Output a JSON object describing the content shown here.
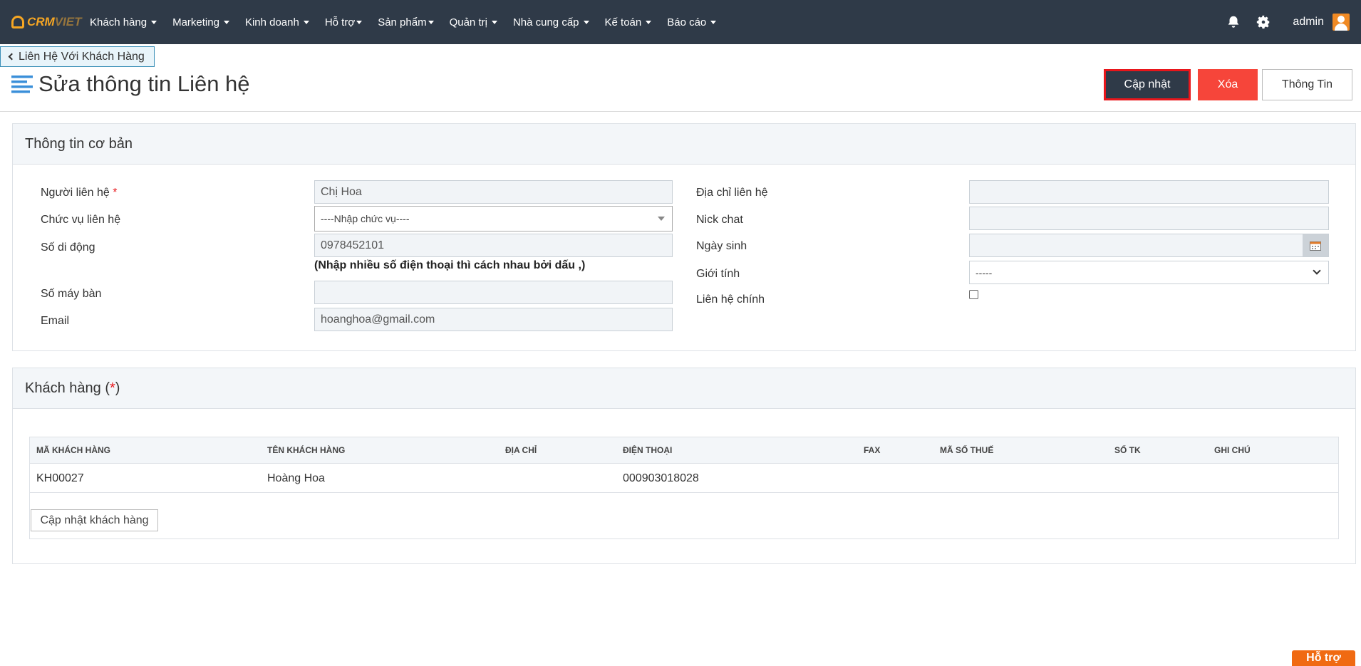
{
  "nav": {
    "logo_crm": "CRM",
    "logo_viet": "VIET",
    "menu": [
      {
        "label": "Khách hàng"
      },
      {
        "label": "Marketing"
      },
      {
        "label": "Kinh doanh"
      },
      {
        "label": "Hỗ trợ"
      },
      {
        "label": "Sản phẩm"
      },
      {
        "label": "Quản trị"
      },
      {
        "label": "Nhà cung cấp"
      },
      {
        "label": "Kế toán"
      },
      {
        "label": "Báo cáo"
      }
    ],
    "user": "admin"
  },
  "breadcrumb": {
    "back_label": "Liên Hệ Với Khách Hàng"
  },
  "page": {
    "title": "Sửa thông tin Liên hệ"
  },
  "actions": {
    "update": "Cập nhật",
    "delete": "Xóa",
    "info": "Thông Tin"
  },
  "basic_info": {
    "heading": "Thông tin cơ bản",
    "contact_person": {
      "label": "Người liên hệ",
      "required": "*",
      "value": "Chị Hoa"
    },
    "position": {
      "label": "Chức vụ liên hệ",
      "value": "----Nhập chức vụ----"
    },
    "mobile": {
      "label": "Số di động",
      "value": "0978452101",
      "hint": "(Nhập nhiều số điện thoại thì cách nhau bởi dấu ,)"
    },
    "landline": {
      "label": "Số máy bàn",
      "value": ""
    },
    "email": {
      "label": "Email",
      "value": "hoanghoa@gmail.com"
    },
    "address": {
      "label": "Địa chỉ liên hệ",
      "value": ""
    },
    "nick_chat": {
      "label": "Nick chat",
      "value": ""
    },
    "birthday": {
      "label": "Ngày sinh",
      "value": ""
    },
    "gender": {
      "label": "Giới tính",
      "value": "-----"
    },
    "primary_contact": {
      "label": "Liên hệ chính",
      "checked": false
    }
  },
  "customers": {
    "heading_prefix": "Khách hàng (",
    "heading_required": "*",
    "heading_suffix": ")",
    "columns": [
      "Mã khách hàng",
      "Tên khách hàng",
      "Địa chỉ",
      "Điện thoại",
      "Fax",
      "Mã số thuế",
      "Số TK",
      "Ghi chú"
    ],
    "rows": [
      {
        "code": "KH00027",
        "name": "Hoàng Hoa",
        "address": "",
        "phone": "000903018028",
        "fax": "",
        "tax": "",
        "account": "",
        "note": ""
      }
    ],
    "update_button": "Cập nhật khách hàng"
  },
  "help": {
    "label": "Hỗ trợ"
  },
  "colors": {
    "nav_bg": "#2f3a48",
    "accent_orange": "#f6a623",
    "danger": "#f6453a",
    "highlight_border": "#e8161b"
  }
}
